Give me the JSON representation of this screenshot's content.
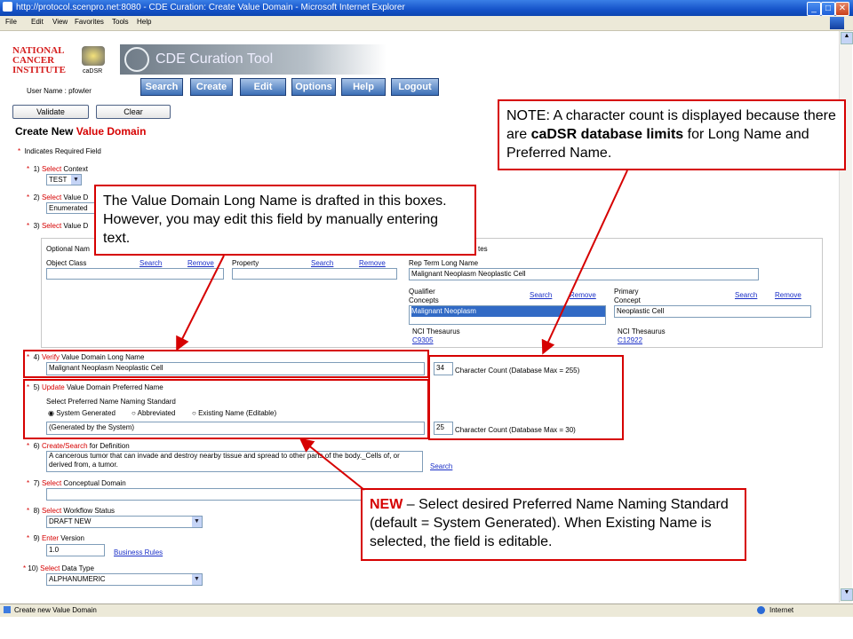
{
  "window": {
    "title": "http://protocol.scenpro.net:8080 - CDE Curation: Create Value Domain - Microsoft Internet Explorer",
    "menu": [
      "File",
      "Edit",
      "View",
      "Favorites",
      "Tools",
      "Help"
    ],
    "status_text": "Create new Value Domain",
    "zone": "Internet"
  },
  "header": {
    "logo_text": [
      "NATIONAL",
      "CANCER",
      "INSTITUTE"
    ],
    "cadsr": "caDSR",
    "tool_title": "CDE Curation Tool",
    "user_label": "User Name : pfowler",
    "nav": [
      "Search",
      "Create",
      "Edit",
      "Options",
      "Help",
      "Logout"
    ]
  },
  "actions": {
    "validate": "Validate",
    "clear": "Clear"
  },
  "page": {
    "title_prefix": "Create New ",
    "title_red": "Value Domain",
    "required_note": "Indicates Required Field"
  },
  "form": {
    "f1": {
      "num": "1)",
      "verb": "Select",
      "rest": " Context",
      "value": "TEST"
    },
    "f2": {
      "num": "2)",
      "verb": "Select",
      "rest": " Value D",
      "value": "Enumerated"
    },
    "f3": {
      "num": "3)",
      "verb": "Select",
      "rest": " Value D"
    },
    "opt": {
      "header": "Optional Nam",
      "obj_class": "Object Class",
      "property": "Property",
      "search": "Search",
      "remove": "Remove",
      "rep_header": "tes",
      "rep_long_label": "Rep Term Long Name",
      "rep_long_value": "Malignant Neoplasm Neoplastic Cell",
      "qual_label": "Qualifier Concepts",
      "qual_value": "Malignant Neoplasm",
      "prim_label": "Primary Concept",
      "prim_value": "Neoplastic Cell",
      "nci": "NCI Thesaurus",
      "code1": "C9305",
      "code2": "C12922"
    },
    "f4": {
      "num": "4)",
      "verb": "Verify",
      "rest": " Value Domain Long Name",
      "value": "Malignant Neoplasm Neoplastic Cell",
      "count": "34",
      "count_label": "Character Count   (Database Max = 255)"
    },
    "f5": {
      "num": "5)",
      "verb": "Update",
      "rest": " Value Domain Preferred Name",
      "naming_label": "Select Preferred Name Naming Standard",
      "radios": [
        "System Generated",
        "Abbreviated",
        "Existing Name (Editable)"
      ],
      "value": "(Generated by the System)",
      "count": "25",
      "count_label": "Character Count   (Database Max = 30)"
    },
    "f6": {
      "num": "6)",
      "verb": "Create/Search",
      "rest": " for Definition",
      "value": "A cancerous tumor that can invade and destroy nearby tissue and spread to other parts of the body._Cells of, or derived from, a tumor.",
      "link": "Search"
    },
    "f7": {
      "num": "7)",
      "verb": "Select",
      "rest": " Conceptual Domain"
    },
    "f8": {
      "num": "8)",
      "verb": "Select",
      "rest": " Workflow Status",
      "value": "DRAFT NEW"
    },
    "f9": {
      "num": "9)",
      "verb": "Enter",
      "rest": " Version",
      "value": "1.0",
      "link": "Business Rules"
    },
    "f10": {
      "num": "10)",
      "verb": "Select",
      "rest": " Data Type",
      "value": "ALPHANUMERIC"
    }
  },
  "callouts": {
    "note_a": "NOTE: A character count is displayed because there are ",
    "note_bold": "caDSR database limits",
    "note_b": " for Long Name and Preferred Name.",
    "long_name": "The Value Domain Long Name is drafted in this boxes. However, you may edit this field by manually entering text.",
    "new_word": "NEW",
    "new_text": " – Select desired Preferred Name Naming Standard (default = System Generated). When Existing Name is selected, the field is editable."
  },
  "colors": {
    "accent": "#d60000",
    "link": "#1a2fc7",
    "titlebar": "#1553c9"
  }
}
